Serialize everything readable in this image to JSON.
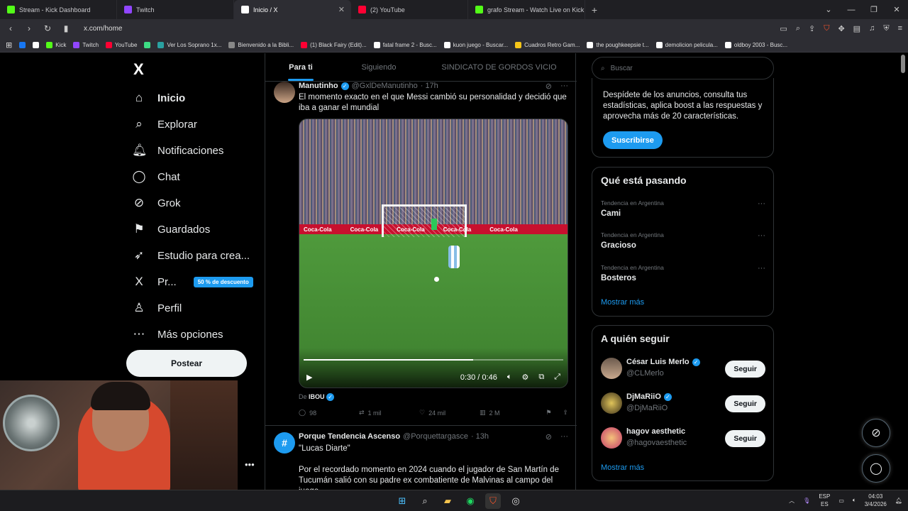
{
  "browser": {
    "tabs": [
      {
        "title": "Stream - Kick Dashboard",
        "color": "#53fc18",
        "active": false
      },
      {
        "title": "Twitch",
        "color": "#9146ff",
        "active": false
      },
      {
        "title": "Inicio / X",
        "color": "#ffffff",
        "active": true
      },
      {
        "title": "(2) YouTube",
        "color": "#ff0033",
        "active": false
      },
      {
        "title": "grafo Stream - Watch Live on Kick",
        "color": "#53fc18",
        "active": false
      }
    ],
    "url": "x.com/home",
    "bookmarks": [
      {
        "label": "",
        "color": "#1877f2"
      },
      {
        "label": "",
        "color": "#ffffff"
      },
      {
        "label": "Kick",
        "color": "#53fc18"
      },
      {
        "label": "Twitch",
        "color": "#9146ff"
      },
      {
        "label": "YouTube",
        "color": "#ff0033"
      },
      {
        "label": "",
        "color": "#3ddc84"
      },
      {
        "label": "Ver Los Soprano 1x...",
        "color": "#2aa1a1"
      },
      {
        "label": "Bienvenido a la Bibli...",
        "color": "#888888"
      },
      {
        "label": "(1) Black Fairy (Edit)...",
        "color": "#ff0033"
      },
      {
        "label": "fatal frame 2 - Busc...",
        "color": "#ffffff"
      },
      {
        "label": "kuon juego - Buscar...",
        "color": "#ffffff"
      },
      {
        "label": "Cuadros Retro Gam...",
        "color": "#f5c518"
      },
      {
        "label": "the poughkeepsie t...",
        "color": "#ffffff"
      },
      {
        "label": "demolicion pelicula...",
        "color": "#ffffff"
      },
      {
        "label": "oldboy 2003 - Busc...",
        "color": "#ffffff"
      }
    ]
  },
  "nav": {
    "logo": "X",
    "items": [
      {
        "label": "Inicio",
        "icon": "home-icon",
        "glyph": "⌂"
      },
      {
        "label": "Explorar",
        "icon": "search-icon",
        "glyph": "⌕"
      },
      {
        "label": "Notificaciones",
        "icon": "bell-icon",
        "glyph": "🔔︎"
      },
      {
        "label": "Chat",
        "icon": "chat-bubble-icon",
        "glyph": "◯"
      },
      {
        "label": "Grok",
        "icon": "grok-icon",
        "glyph": "⊘"
      },
      {
        "label": "Guardados",
        "icon": "bookmark-icon",
        "glyph": "⚑"
      },
      {
        "label": "Estudio para crea...",
        "icon": "rocket-icon",
        "glyph": "➶"
      },
      {
        "label": "Pr...",
        "icon": "x-premium-icon",
        "glyph": "X"
      },
      {
        "label": "Perfil",
        "icon": "person-icon",
        "glyph": "♙"
      },
      {
        "label": "Más opciones",
        "icon": "more-circle-icon",
        "glyph": "⋯"
      }
    ],
    "promo_badge": "50 % de descuento",
    "post_button": "Postear"
  },
  "feed": {
    "tabs": [
      "Para ti",
      "Siguiendo",
      "SINDICATO DE GORDOS VICIO"
    ],
    "tweet1": {
      "name": "Manutinho",
      "handle": "@GxlDeManutinho",
      "time": "· 17h",
      "text": "El momento exacto en el que Messi cambió su personalidad y decidió que iba a ganar el mundial",
      "video": {
        "ads": [
          "Coca-Cola",
          "Coca-Cola",
          "Coca-Cola",
          "Coca-Cola",
          "Coca-Cola"
        ],
        "time": "0:30 / 0:46",
        "progress": 0.652
      },
      "source_prefix": "De",
      "source_name": "IBOU",
      "replies": "98",
      "reposts": "1 mil",
      "likes": "24 mil",
      "views": "2 M"
    },
    "tweet2": {
      "name": "Porque Tendencia Ascenso",
      "handle": "@Porquettargasce",
      "time": "· 13h",
      "text1": "\"Lucas Diarte\"",
      "text2": "Por el recordado momento en 2024 cuando el jugador de San Martín de Tucumán salió con su padre ex combatiente de Malvinas al campo del juego"
    }
  },
  "sidebar": {
    "search_placeholder": "Buscar",
    "premium": {
      "text": "Despídete de los anuncios, consulta tus estadísticas, aplica boost a las respuestas y aprovecha más de 20 características.",
      "button": "Suscribirse"
    },
    "trending": {
      "title": "Qué está pasando",
      "items": [
        {
          "context": "Tendencia en Argentina",
          "name": "Cami"
        },
        {
          "context": "Tendencia en Argentina",
          "name": "Gracioso"
        },
        {
          "context": "Tendencia en Argentina",
          "name": "Bosteros"
        }
      ],
      "show_more": "Mostrar más"
    },
    "who_to_follow": {
      "title": "A quién seguir",
      "items": [
        {
          "name": "César Luis Merlo",
          "handle": "@CLMerlo",
          "verified": true,
          "button": "Seguir"
        },
        {
          "name": "DjMaRiiO",
          "handle": "@DjMaRiiO",
          "verified": true,
          "button": "Seguir"
        },
        {
          "name": "hagov aesthetic",
          "handle": "@hagovaesthetic",
          "verified": false,
          "button": "Seguir"
        }
      ],
      "show_more": "Mostrar más"
    }
  },
  "taskbar": {
    "lang_top": "ESP",
    "lang_bottom": "ES",
    "time": "04:03",
    "date": "3/4/2026"
  }
}
